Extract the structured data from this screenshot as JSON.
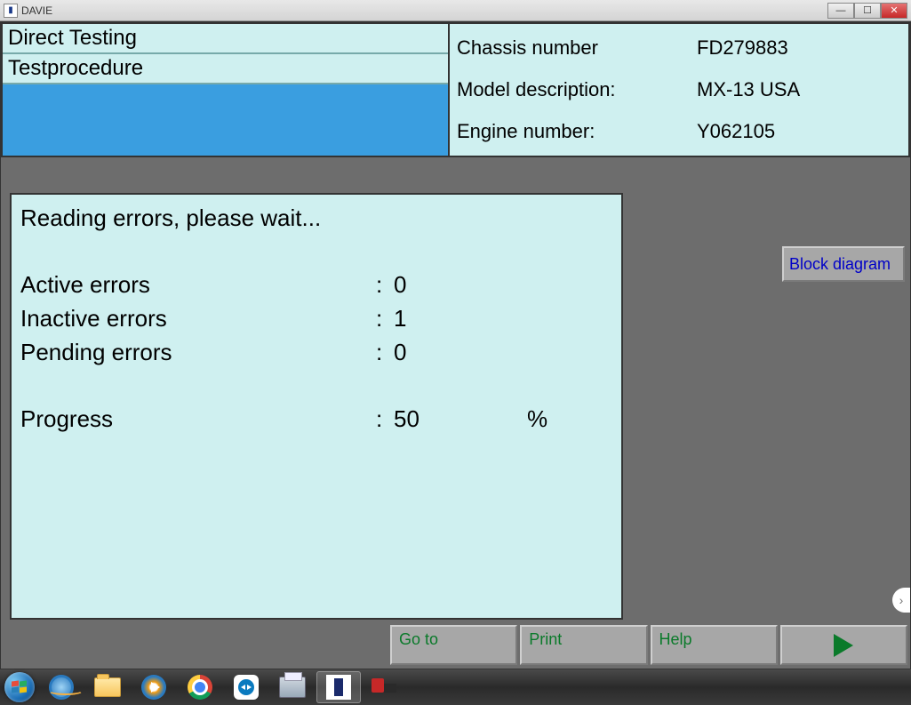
{
  "titlebar": {
    "app_name": "DAVIE"
  },
  "header": {
    "left": {
      "row1": "Direct Testing",
      "row2": "Testprocedure"
    },
    "right": {
      "chassis_label": "Chassis number",
      "chassis_value": "FD279883",
      "model_label": "Model description:",
      "model_value": "MX-13 USA",
      "engine_label": "Engine number:",
      "engine_value": "Y062105"
    }
  },
  "status": {
    "heading": "Reading errors, please wait...",
    "active_label": "Active errors",
    "active_value": "0",
    "inactive_label": "Inactive errors",
    "inactive_value": "1",
    "pending_label": "Pending errors",
    "pending_value": "0",
    "progress_label": "Progress",
    "progress_value": "50",
    "progress_unit": "%"
  },
  "buttons": {
    "block_diagram": "Block diagram",
    "goto": "Go to",
    "print": "Print",
    "help": "Help"
  }
}
